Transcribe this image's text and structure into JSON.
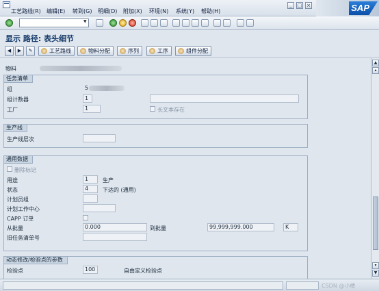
{
  "menu": [
    "工艺路线(R)",
    "编辑(E)",
    "转到(G)",
    "明细(D)",
    "附加(X)",
    "环境(N)",
    "系统(Y)",
    "帮助(H)"
  ],
  "sap_logo": "SAP",
  "toolbar": {
    "command_value": "",
    "command_dropdown": "▼"
  },
  "page_title": "显示 路径: 表头细节",
  "nav_buttons": [
    "工艺路线",
    "物料分配",
    "序列",
    "工序",
    "组件分配"
  ],
  "material": {
    "label": "物料"
  },
  "task_list": {
    "title": "任务清单",
    "group_label": "组",
    "group_value": "5",
    "counter_label": "组计数器",
    "counter_value": "1",
    "plant_label": "工厂",
    "plant_value": "1",
    "long_text_label": "长文本存在"
  },
  "production_line": {
    "title": "生产线",
    "level_label": "生产线层次"
  },
  "general": {
    "title": "通用数据",
    "delete_flag_label": "删除标记",
    "usage_label": "用途",
    "usage_value": "1",
    "usage_text": "生产",
    "status_label": "状态",
    "status_value": "4",
    "status_text": "下达的 (通用)",
    "planner_group_label": "计划员组",
    "work_center_label": "计划工作中心",
    "capp_label": "CAPP 订单",
    "from_lot_label": "从批量",
    "from_lot_value": "0.000",
    "to_lot_label": "到批量",
    "to_lot_value": "99,999,999.000",
    "unit_value": "K",
    "old_task_label": "旧任务清单号"
  },
  "dynamic": {
    "title": "动态修改/检验点的参数",
    "inspection_label": "检验点",
    "inspection_value": "100",
    "custom_label": "自由定义检验点"
  },
  "statusbar": {
    "watermark": "CSDN @小楼"
  }
}
